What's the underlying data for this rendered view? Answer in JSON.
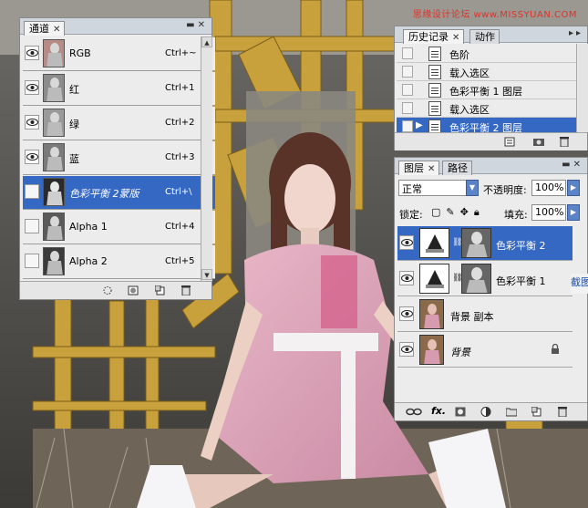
{
  "watermark": "思缘设计论坛 www.MISSYUAN.COM",
  "channels_panel": {
    "tab_label": "通道",
    "rows": [
      {
        "name": "RGB",
        "shortcut": "Ctrl+~",
        "visible": true,
        "selected": false
      },
      {
        "name": "红",
        "shortcut": "Ctrl+1",
        "visible": true,
        "selected": false
      },
      {
        "name": "绿",
        "shortcut": "Ctrl+2",
        "visible": true,
        "selected": false
      },
      {
        "name": "蓝",
        "shortcut": "Ctrl+3",
        "visible": true,
        "selected": false
      },
      {
        "name": "色彩平衡 2蒙版",
        "shortcut": "Ctrl+\\",
        "visible": false,
        "selected": true
      },
      {
        "name": "Alpha 1",
        "shortcut": "Ctrl+4",
        "visible": false,
        "selected": false
      },
      {
        "name": "Alpha 2",
        "shortcut": "Ctrl+5",
        "visible": false,
        "selected": false
      }
    ]
  },
  "history_panel": {
    "tabs": [
      "历史记录",
      "动作"
    ],
    "items": [
      {
        "label": "色阶",
        "selected": false
      },
      {
        "label": "载入选区",
        "selected": false
      },
      {
        "label": "色彩平衡 1 图层",
        "selected": false
      },
      {
        "label": "载入选区",
        "selected": false
      },
      {
        "label": "色彩平衡 2 图层",
        "selected": true
      }
    ]
  },
  "layers_panel": {
    "tabs": [
      "图层",
      "路径"
    ],
    "blend_mode": "正常",
    "opacity_label": "不透明度:",
    "opacity_value": "100%",
    "lock_label": "锁定:",
    "fill_label": "填充:",
    "fill_value": "100%",
    "layers": [
      {
        "name": "色彩平衡 2",
        "type": "adjustment",
        "selected": true
      },
      {
        "name": "色彩平衡 1",
        "type": "adjustment",
        "selected": false
      },
      {
        "name": "背景 副本",
        "type": "image",
        "selected": false
      },
      {
        "name": "背景",
        "type": "background",
        "selected": false
      }
    ]
  },
  "side_label": "截图"
}
